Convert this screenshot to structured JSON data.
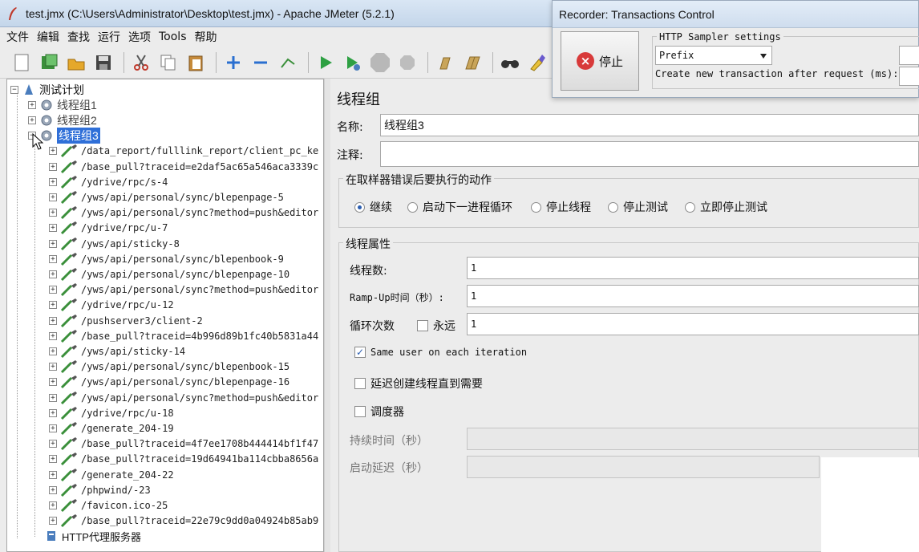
{
  "window": {
    "title": "test.jmx (C:\\Users\\Administrator\\Desktop\\test.jmx) - Apache JMeter (5.2.1)"
  },
  "menu": [
    "文件",
    "编辑",
    "查找",
    "运行",
    "选项",
    "Tools",
    "帮助"
  ],
  "toolbar_icons": [
    "new-icon",
    "templates-icon",
    "open-icon",
    "save-icon",
    "cut-icon",
    "copy-icon",
    "paste-icon",
    "expand-icon",
    "collapse-icon",
    "toggle-icon",
    "start-icon",
    "start-no-pause-icon",
    "stop-icon",
    "shutdown-icon",
    "clear-icon",
    "clear-all-icon",
    "search-icon",
    "reset-search-icon"
  ],
  "tree": {
    "root": "测试计划",
    "groups": [
      "线程组1",
      "线程组2",
      "线程组3"
    ],
    "requests": [
      "/data_report/fulllink_report/client_pc_ke",
      "/base_pull?traceid=e2daf5ac65a546aca3339c",
      "/ydrive/rpc/s-4",
      "/yws/api/personal/sync/blepenpage-5",
      "/yws/api/personal/sync?method=push&editor",
      "/ydrive/rpc/u-7",
      "/yws/api/sticky-8",
      "/yws/api/personal/sync/blepenbook-9",
      "/yws/api/personal/sync/blepenpage-10",
      "/yws/api/personal/sync?method=push&editor",
      "/ydrive/rpc/u-12",
      "/pushserver3/client-2",
      "/base_pull?traceid=4b996d89b1fc40b5831a44",
      "/yws/api/sticky-14",
      "/yws/api/personal/sync/blepenbook-15",
      "/yws/api/personal/sync/blepenpage-16",
      "/yws/api/personal/sync?method=push&editor",
      "/ydrive/rpc/u-18",
      "/generate_204-19",
      "/base_pull?traceid=4f7ee1708b444414bf1f47",
      "/base_pull?traceid=19d64941ba114cbba8656a",
      "/generate_204-22",
      "/phpwind/-23",
      "/favicon.ico-25",
      "/base_pull?traceid=22e79c9dd0a04924b85ab9"
    ],
    "proxy": "HTTP代理服务器"
  },
  "panel": {
    "title": "线程组",
    "name_label": "名称:",
    "name_value": "线程组3",
    "comment_label": "注释:",
    "comment_value": "",
    "on_error_legend": "在取样器错误后要执行的动作",
    "on_error_options": [
      "继续",
      "启动下一进程循环",
      "停止线程",
      "停止测试",
      "立即停止测试"
    ],
    "on_error_selected": 0,
    "props_legend": "线程属性",
    "threads_label": "线程数:",
    "threads_value": "1",
    "rampup_label": "Ramp-Up时间（秒）:",
    "rampup_value": "1",
    "loop_label": "循环次数",
    "forever_label": "永远",
    "loop_value": "1",
    "same_user_label": "Same user on each iteration",
    "same_user_checked": true,
    "delay_label": "延迟创建线程直到需要",
    "scheduler_label": "调度器",
    "duration_label": "持续时间（秒）",
    "startup_delay_label": "启动延迟（秒）"
  },
  "recorder": {
    "title": "Recorder: Transactions Control",
    "stop_label": "停止",
    "sampler_legend": "HTTP Sampler settings",
    "prefix_value": "Prefix",
    "create_tx_label": "Create new transaction after request (ms):"
  }
}
